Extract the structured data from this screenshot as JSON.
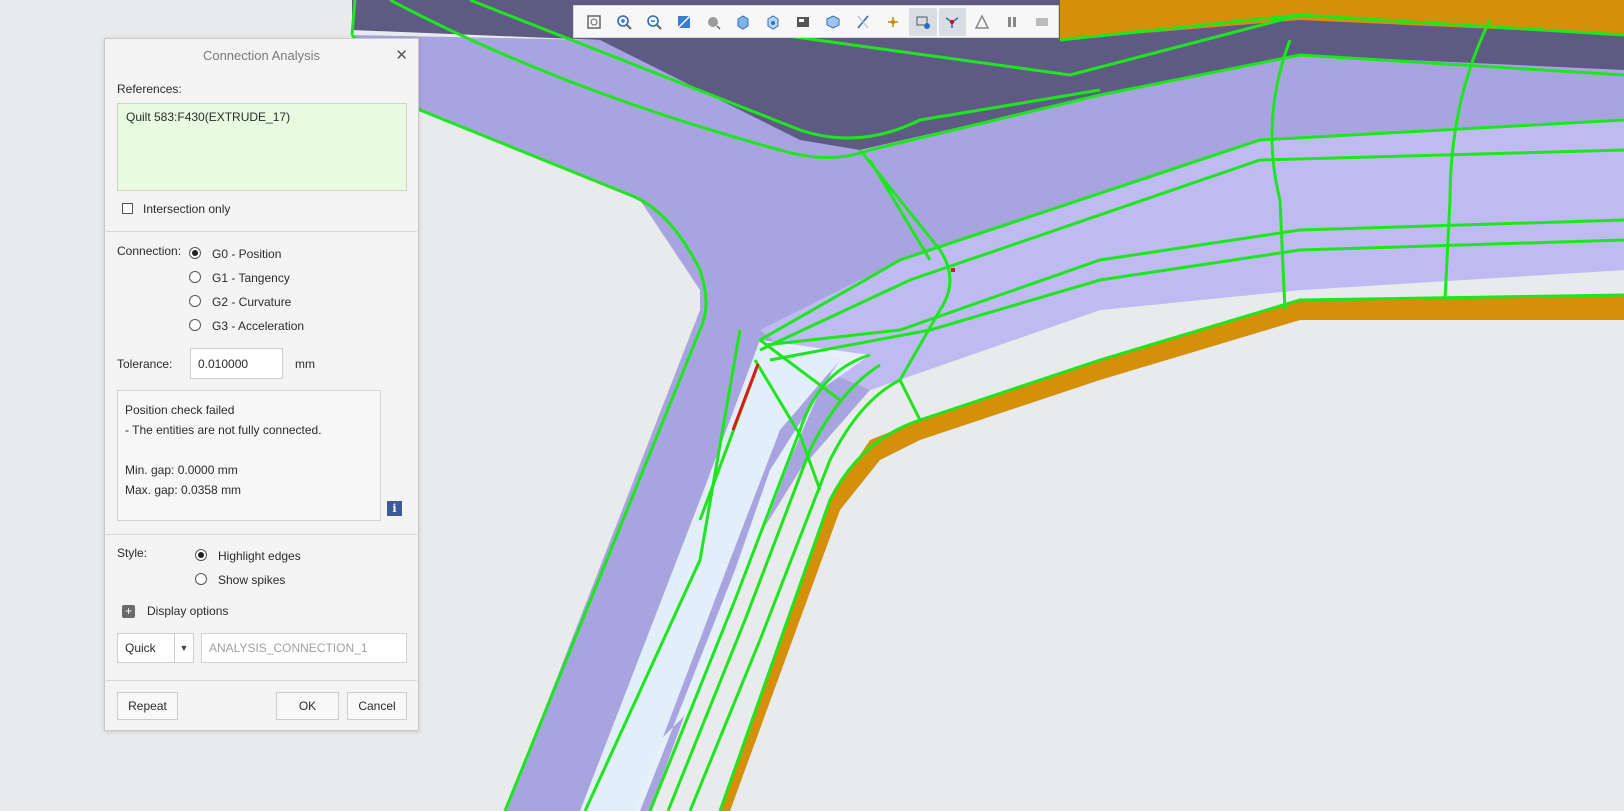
{
  "dialog": {
    "title": "Connection Analysis",
    "references_label": "References:",
    "reference_value": "Quilt 583:F430(EXTRUDE_17)",
    "intersection_only_label": "Intersection only",
    "intersection_only_checked": false,
    "connection_label": "Connection:",
    "connection_options": [
      {
        "label": "G0 - Position",
        "selected": true
      },
      {
        "label": "G1 - Tangency",
        "selected": false
      },
      {
        "label": "G2 - Curvature",
        "selected": false
      },
      {
        "label": "G3 - Acceleration",
        "selected": false
      }
    ],
    "tolerance_label": "Tolerance:",
    "tolerance_value": "0.010000",
    "tolerance_unit": "mm",
    "result_lines": [
      "Position check failed",
      "- The entities are not fully connected.",
      "",
      "Min. gap: 0.0000 mm",
      "Max. gap: 0.0358 mm"
    ],
    "style_label": "Style:",
    "style_options": [
      {
        "label": "Highlight edges",
        "selected": true
      },
      {
        "label": "Show spikes",
        "selected": false
      }
    ],
    "display_options_label": "Display options",
    "mode_value": "Quick",
    "analysis_name_placeholder": "ANALYSIS_CONNECTION_1",
    "repeat_label": "Repeat",
    "ok_label": "OK",
    "cancel_label": "Cancel"
  },
  "toolbar": {
    "icons": [
      "refit-icon",
      "zoom-in-icon",
      "zoom-out-icon",
      "repaint-icon",
      "display-style-icon",
      "saved-orientations-icon",
      "view-manager-icon",
      "annotation-display-icon",
      "section-icon",
      "datum-display-icon",
      "point-display-icon",
      "spin-center-icon",
      "connection-analysis-icon",
      "appearance-icon",
      "pause-icon",
      "hide-icon"
    ],
    "active_icons": [
      "spin-center-icon",
      "connection-analysis-icon"
    ]
  },
  "colors": {
    "surface": "#a8a4e0",
    "surface_light": "#c0bcf0",
    "fillet_highlight": "#e6f0fb",
    "edge_highlight": "#1ee61e",
    "gap_edge": "#e01818",
    "orange_band": "#d4900a",
    "dark_band": "#5e5a84"
  }
}
